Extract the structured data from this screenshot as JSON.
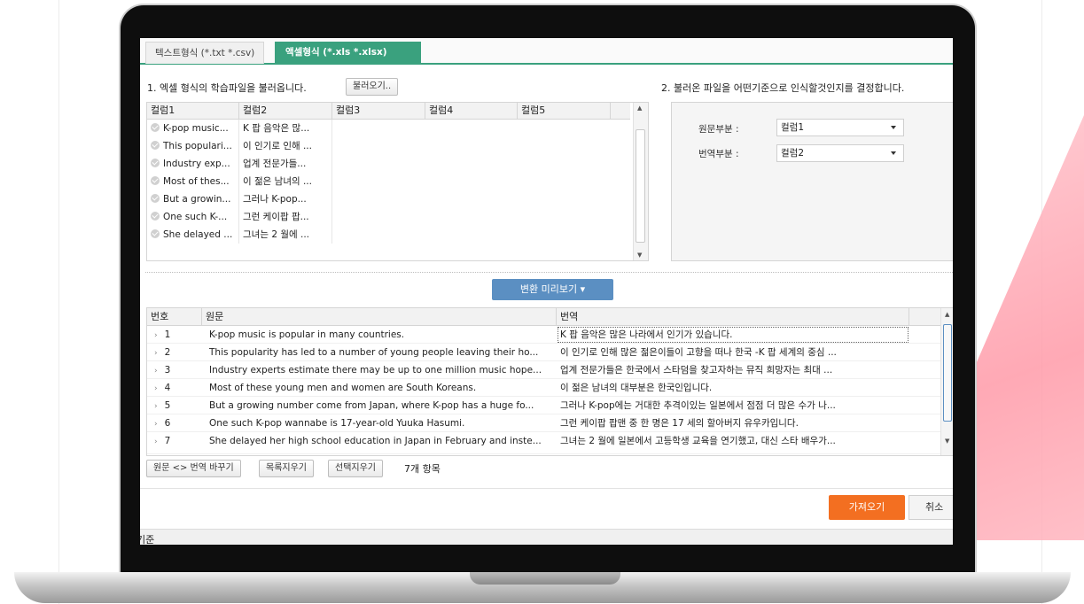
{
  "tabs": [
    "텍스트형식 (*.txt *.csv)",
    "액셀형식 (*.xls *.xlsx)"
  ],
  "step1": {
    "label": "1. 엑셀 형식의 학습파일을 불러옵니다.",
    "button": "불러오기.."
  },
  "step2": {
    "label": "2. 불러온 파일을 어떤기준으로 인식할것인지를 결정합니다."
  },
  "columns": [
    "컬럼1",
    "컬럼2",
    "컬럼3",
    "컬럼4",
    "컬럼5"
  ],
  "file_rows": [
    [
      "K-pop music...",
      "K 팝 음악은 많..."
    ],
    [
      "This populari...",
      "이 인기로 인해 ..."
    ],
    [
      "Industry exp...",
      "업계 전문가들..."
    ],
    [
      "Most of thes...",
      "이 젊은 남녀의 ..."
    ],
    [
      "But a growin...",
      "그러나 K-pop..."
    ],
    [
      "One such K-...",
      "그런 케이팝 팝..."
    ],
    [
      "She delayed ...",
      "그녀는 2 월에 ..."
    ]
  ],
  "mapping": {
    "source_label": "원문부분 :",
    "source_value": "컬럼1",
    "target_label": "번역부분 :",
    "target_value": "컬럼2"
  },
  "preview_button": "변환 미리보기 ▾",
  "preview": {
    "headers": [
      "번호",
      "원문",
      "번역"
    ],
    "rows": [
      {
        "no": "1",
        "source": "K-pop music is popular in many countries.",
        "target": "K 팝 음악은 많은 나라에서 인기가 있습니다."
      },
      {
        "no": "2",
        "source": "This popularity has led to a number of young people leaving their ho...",
        "target": "이 인기로 인해 많은 젊은이들이 고향을 떠나 한국 -K 팝 세계의 중심 ..."
      },
      {
        "no": "3",
        "source": "Industry experts estimate there may be up to one million music hope...",
        "target": "업계 전문가들은 한국에서 스타덤을 찾고자하는 뮤직 희망자는 최대 ..."
      },
      {
        "no": "4",
        "source": "Most of these young men and women are South Koreans.",
        "target": "이 젊은 남녀의 대부분은 한국인입니다."
      },
      {
        "no": "5",
        "source": "But a growing number come from Japan, where K-pop has a huge fo...",
        "target": "그러나 K-pop에는 거대한 추격이있는 일본에서 점점 더 많은 수가 나..."
      },
      {
        "no": "6",
        "source": "One such K-pop wannabe is 17-year-old Yuuka Hasumi.",
        "target": "그런 케이팝 팝맨 중 한 명은 17 세의 할아버지 유우카입니다."
      },
      {
        "no": "7",
        "source": "She delayed her high school education in Japan in February and inste...",
        "target": "그녀는 2 월에 일본에서 고등학생 교육을 연기했고, 대신 스타 배우가..."
      }
    ]
  },
  "toolbar": {
    "swap": "원문 <> 번역 바꾸기",
    "clear_list": "목록지우기",
    "clear_selected": "선택지우기",
    "count": "7개 항목"
  },
  "actions": {
    "import": "가져오기",
    "cancel": "취소"
  },
  "status": "기준",
  "colors": {
    "accent_green": "#3aa17e",
    "import_orange": "#f36f21",
    "preview_blue": "#5b8fc2"
  }
}
